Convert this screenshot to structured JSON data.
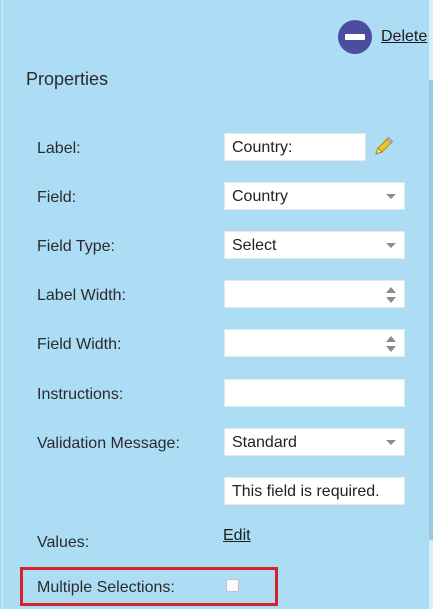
{
  "header": {
    "delete_label": "Delete"
  },
  "properties": {
    "title": "Properties",
    "label": {
      "label": "Label:",
      "value": "Country:"
    },
    "field": {
      "label": "Field:",
      "value": "Country"
    },
    "field_type": {
      "label": "Field Type:",
      "value": "Select"
    },
    "label_width": {
      "label": "Label Width:",
      "value": ""
    },
    "field_width": {
      "label": "Field Width:",
      "value": ""
    },
    "instructions": {
      "label": "Instructions:",
      "value": ""
    },
    "validation_message": {
      "label": "Validation Message:",
      "value": "Standard",
      "text": "This field is required."
    },
    "values": {
      "label": "Values:",
      "link": "Edit"
    },
    "multiple_selections": {
      "label": "Multiple Selections:",
      "checked": false
    }
  },
  "colors": {
    "panel_bg": "#addcf5",
    "delete_icon": "#4b4e9e",
    "highlight_border": "#d6222a"
  },
  "icons": {
    "delete": "minus-circle-icon",
    "pencil": "pencil-icon"
  }
}
